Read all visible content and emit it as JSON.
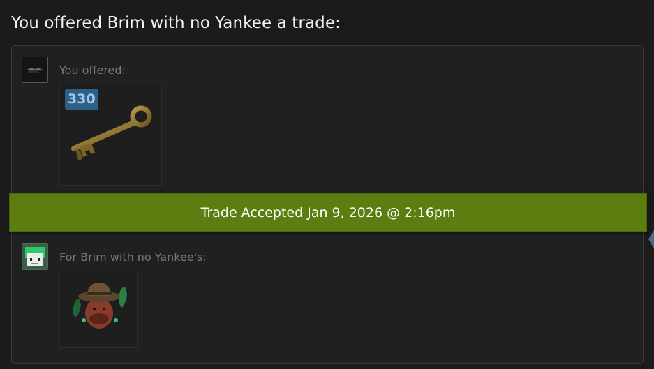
{
  "header": {
    "title": "You offered Brim with no Yankee a trade:"
  },
  "offer": {
    "you_offered_label": "You offered:",
    "items": [
      {
        "icon": "mann-co-key-icon",
        "quantity_badge": "330"
      }
    ]
  },
  "status_banner": {
    "text": "Trade Accepted Jan 9, 2026 @ 2:16pm"
  },
  "receive": {
    "for_label": "For Brim with no Yankee's:",
    "items": [
      {
        "icon": "cosmetic-hat-item-icon"
      }
    ]
  },
  "colors": {
    "banner_green": "#5c7e10",
    "badge_blue": "#2d5f87",
    "background": "#1b1b1b"
  }
}
